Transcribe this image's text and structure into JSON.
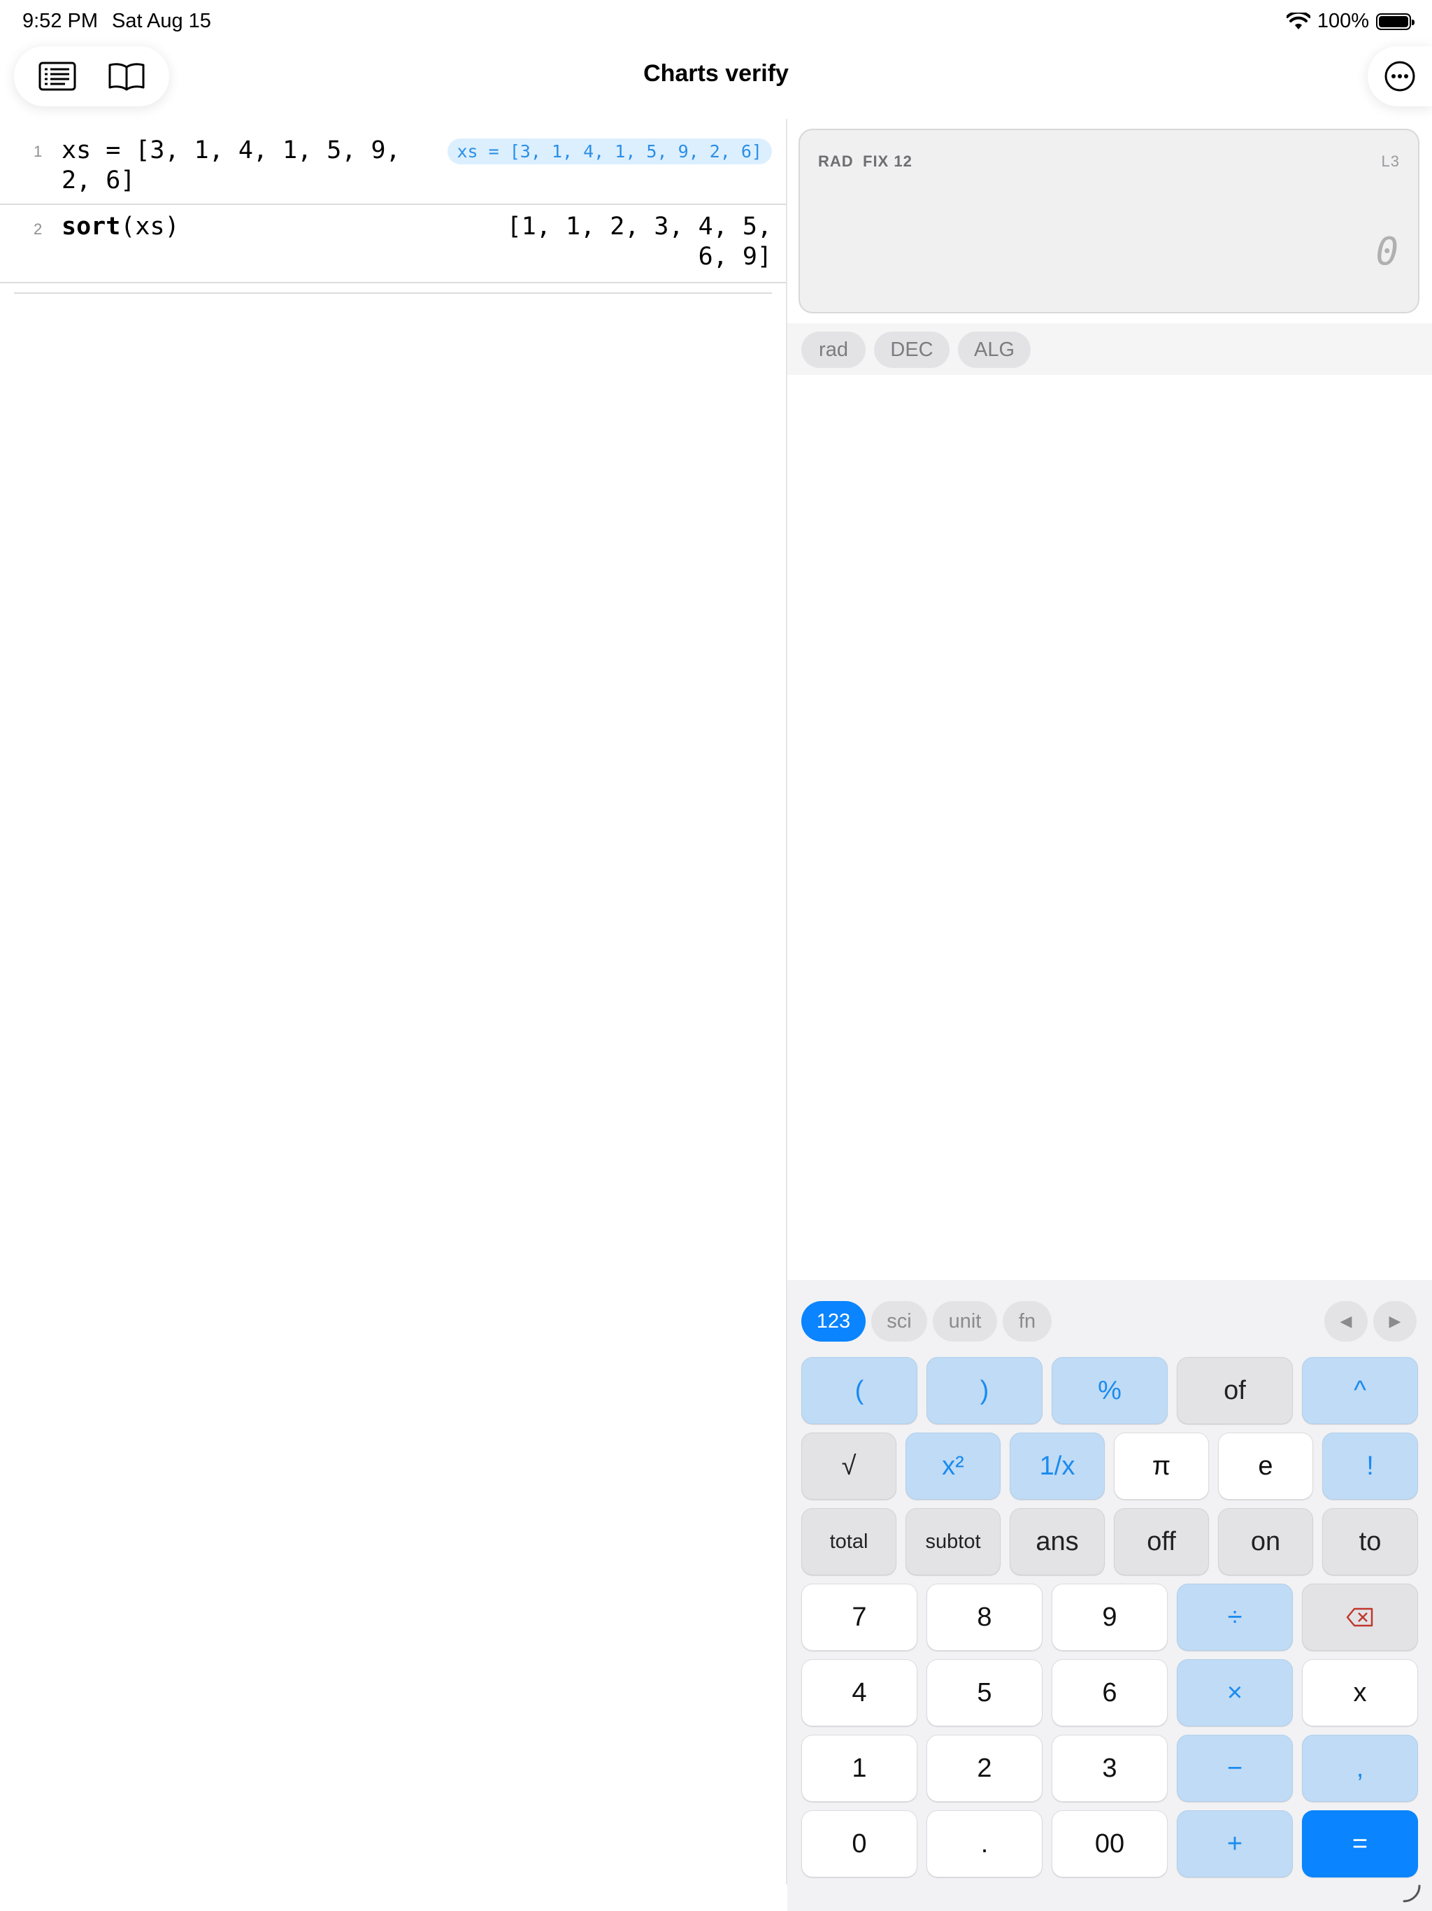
{
  "status_bar": {
    "time": "9:52 PM",
    "date": "Sat Aug 15",
    "battery": "100%"
  },
  "nav": {
    "title": "Charts verify",
    "left_icons": [
      "list-icon",
      "book-icon"
    ],
    "right_icon": "more-icon"
  },
  "editor": {
    "lines": [
      {
        "number": "1",
        "code": "xs = [3, 1, 4, 1, 5, 9,\n2, 6]",
        "result_chip": "xs = [3, 1, 4, 1, 5, 9, 2, 6]"
      },
      {
        "number": "2",
        "code_fn": "sort",
        "code_args": "(xs)",
        "result": "[1, 1, 2, 3, 4, 5,\n6, 9]"
      }
    ]
  },
  "display": {
    "angle_mode": "RAD",
    "format": "FIX 12",
    "stack_level": "L3",
    "value": "0"
  },
  "mode_chips": [
    "rad",
    "DEC",
    "ALG"
  ],
  "keyboard": {
    "tabs": [
      "123",
      "sci",
      "unit",
      "fn"
    ],
    "active_tab": "123",
    "arrows": [
      "◀",
      "▶"
    ],
    "row1": [
      "(",
      ")",
      "%",
      "of",
      "^"
    ],
    "row2": [
      "√",
      "x²",
      "1/x",
      "π",
      "e",
      "!"
    ],
    "row3": [
      "total",
      "subtot",
      "ans",
      "off",
      "on",
      "to"
    ],
    "row4": [
      "7",
      "8",
      "9",
      "÷",
      "backspace-icon"
    ],
    "row5": [
      "4",
      "5",
      "6",
      "×",
      "x"
    ],
    "row6": [
      "1",
      "2",
      "3",
      "−",
      ","
    ],
    "row7": [
      "0",
      ".",
      "00",
      "+",
      "="
    ]
  },
  "colors": {
    "accent": "#0a84ff",
    "accent_light": "#c0dbf5",
    "chip_bg": "#dcefff",
    "chip_text": "#2b8fe6"
  }
}
